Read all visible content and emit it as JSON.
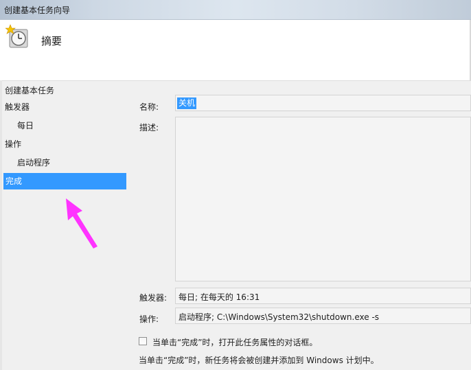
{
  "window": {
    "title": "创建基本任务向导"
  },
  "header": {
    "title": "摘要",
    "icon": "task-clock-icon"
  },
  "sidebar": {
    "items": [
      {
        "label": "创建基本任务",
        "indent": false,
        "selected": false
      },
      {
        "label": "触发器",
        "indent": false,
        "selected": false
      },
      {
        "label": "每日",
        "indent": true,
        "selected": false
      },
      {
        "label": "操作",
        "indent": false,
        "selected": false
      },
      {
        "label": "启动程序",
        "indent": true,
        "selected": false
      },
      {
        "label": "完成",
        "indent": false,
        "selected": true
      }
    ]
  },
  "form": {
    "name_label": "名称:",
    "name_value": "关机",
    "description_label": "描述:",
    "description_value": "",
    "trigger_label": "触发器:",
    "trigger_value": "每日; 在每天的 16:31",
    "action_label": "操作:",
    "action_value": "启动程序; C:\\Windows\\System32\\shutdown.exe -s",
    "open_properties_checkbox": {
      "label": "当单击“完成”时，打开此任务属性的对话框。",
      "checked": false
    },
    "info": "当单击“完成”时，新任务将会被创建并添加到 Windows 计划中。"
  },
  "colors": {
    "selection": "#3399ff",
    "arrow": "#ff33ff"
  }
}
